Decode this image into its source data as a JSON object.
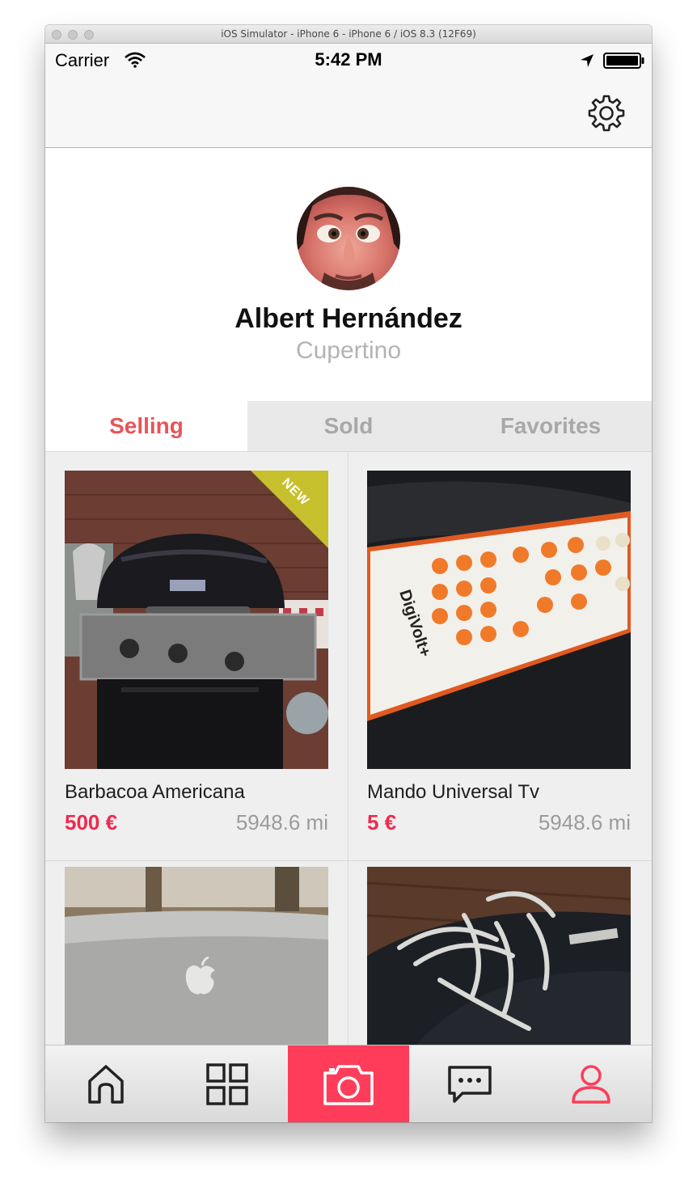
{
  "window": {
    "title": "iOS Simulator - iPhone 6 - iPhone 6 / iOS 8.3 (12F69)"
  },
  "status_bar": {
    "carrier": "Carrier",
    "time": "5:42 PM"
  },
  "profile": {
    "name": "Albert Hernández",
    "location": "Cupertino"
  },
  "tabs": [
    {
      "label": "Selling",
      "active": true
    },
    {
      "label": "Sold",
      "active": false
    },
    {
      "label": "Favorites",
      "active": false
    }
  ],
  "products": [
    {
      "title": "Barbacoa Americana",
      "price": "500 €",
      "distance": "5948.6 mi",
      "badge": "NEW"
    },
    {
      "title": "Mando Universal Tv",
      "price": "5 €",
      "distance": "5948.6 mi"
    }
  ],
  "tab_bar": {
    "items": [
      {
        "icon": "home-icon"
      },
      {
        "icon": "grid-icon"
      },
      {
        "icon": "camera-icon"
      },
      {
        "icon": "chat-icon"
      },
      {
        "icon": "profile-icon",
        "active": true
      }
    ]
  },
  "colors": {
    "accent": "#f0294e",
    "active_tab": "#e8545a",
    "camera": "#ff3d5a",
    "muted": "#a8a8a8",
    "badge": "#c6c02c"
  }
}
